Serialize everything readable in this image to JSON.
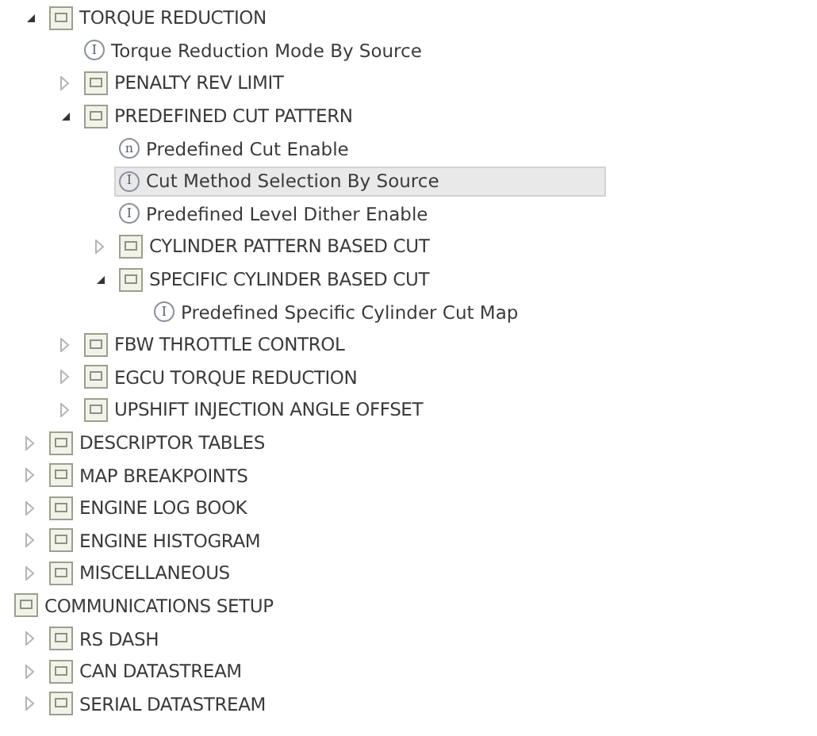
{
  "tree": {
    "continued_items": [
      {
        "kind": "folder",
        "label": "TORQUE REDUCTION",
        "expanded": true,
        "selected": false,
        "children": [
          {
            "kind": "parameter",
            "badge": "I",
            "label": "Torque Reduction Mode By Source",
            "selected": false
          },
          {
            "kind": "folder",
            "label": "PENALTY REV LIMIT",
            "expanded": false,
            "selected": false
          },
          {
            "kind": "folder",
            "label": "PREDEFINED CUT PATTERN",
            "expanded": true,
            "selected": false,
            "children": [
              {
                "kind": "parameter",
                "badge": "n",
                "label": "Predefined Cut Enable",
                "selected": false
              },
              {
                "kind": "parameter",
                "badge": "I",
                "label": "Cut Method Selection By Source",
                "selected": true
              },
              {
                "kind": "parameter",
                "badge": "I",
                "label": "Predefined Level Dither Enable",
                "selected": false
              },
              {
                "kind": "folder",
                "label": "CYLINDER PATTERN BASED CUT",
                "expanded": false,
                "selected": false
              },
              {
                "kind": "folder",
                "label": "SPECIFIC CYLINDER BASED CUT",
                "expanded": true,
                "selected": false,
                "children": [
                  {
                    "kind": "parameter",
                    "badge": "I",
                    "label": "Predefined Specific Cylinder Cut Map",
                    "selected": false
                  }
                ]
              }
            ]
          },
          {
            "kind": "folder",
            "label": "FBW THROTTLE CONTROL",
            "expanded": false,
            "selected": false
          },
          {
            "kind": "folder",
            "label": "EGCU TORQUE REDUCTION",
            "expanded": false,
            "selected": false
          },
          {
            "kind": "folder",
            "label": "UPSHIFT INJECTION ANGLE OFFSET",
            "expanded": false,
            "selected": false
          }
        ]
      },
      {
        "kind": "folder",
        "label": "DESCRIPTOR TABLES",
        "expanded": false,
        "selected": false
      },
      {
        "kind": "folder",
        "label": "MAP BREAKPOINTS",
        "expanded": false,
        "selected": false
      },
      {
        "kind": "folder",
        "label": "ENGINE LOG BOOK",
        "expanded": false,
        "selected": false
      },
      {
        "kind": "folder",
        "label": "ENGINE HISTOGRAM",
        "expanded": false,
        "selected": false
      },
      {
        "kind": "folder",
        "label": "MISCELLANEOUS",
        "expanded": false,
        "selected": false
      }
    ],
    "root_items": [
      {
        "kind": "folder",
        "label": "COMMUNICATIONS SETUP",
        "selected": false,
        "children": [
          {
            "kind": "folder",
            "label": "RS DASH",
            "expanded": false,
            "selected": false
          },
          {
            "kind": "folder",
            "label": "CAN DATASTREAM",
            "expanded": false,
            "selected": false
          },
          {
            "kind": "folder",
            "label": "SERIAL DATASTREAM",
            "expanded": false,
            "selected": false
          }
        ]
      }
    ]
  }
}
